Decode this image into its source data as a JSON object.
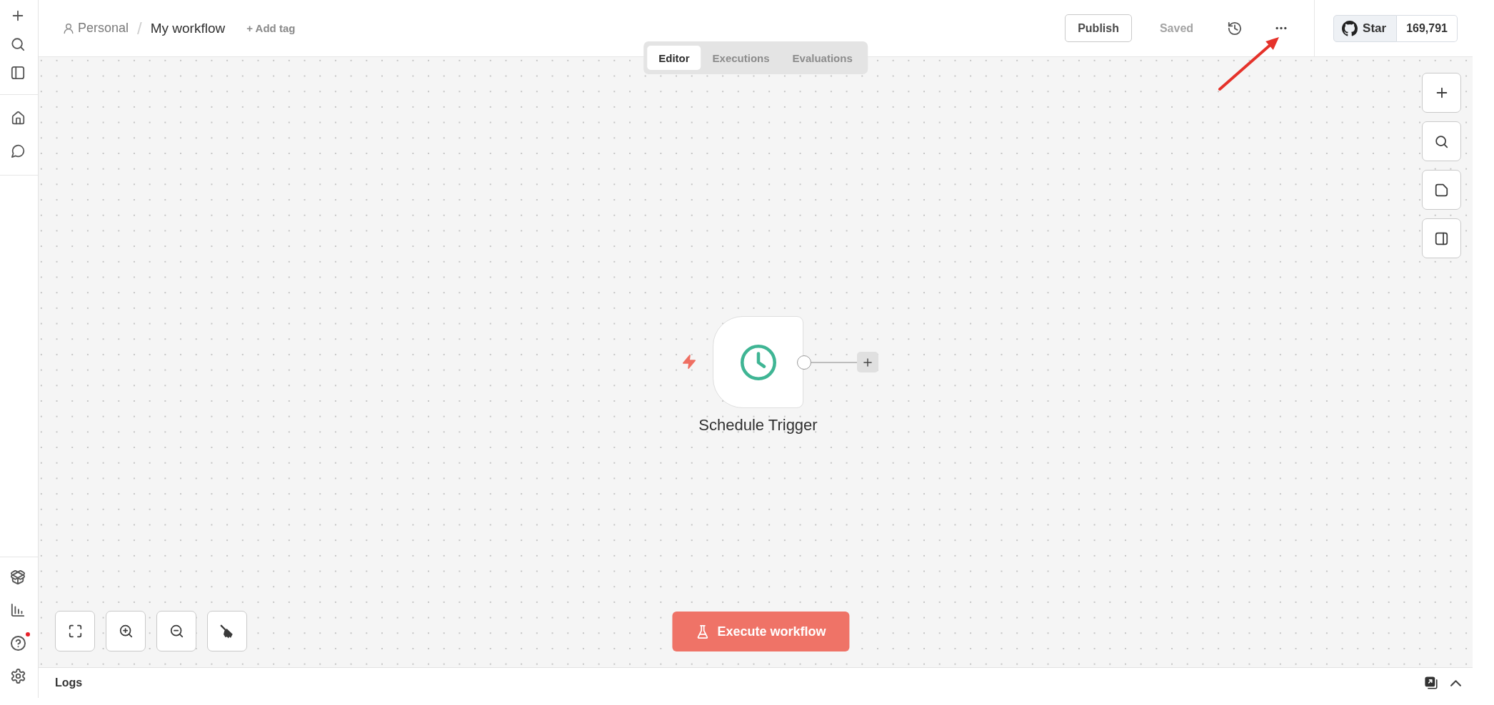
{
  "sidebar": {
    "help_notification": true
  },
  "header": {
    "breadcrumb": {
      "project": "Personal",
      "separator": "/",
      "workflow_name": "My workflow",
      "add_tag": "+ Add tag"
    },
    "publish_button": "Publish",
    "save_status": "Saved",
    "github_star": {
      "label": "Star",
      "count": "169,791"
    }
  },
  "view_tabs": [
    {
      "label": "Editor",
      "selected": true
    },
    {
      "label": "Executions",
      "selected": false
    },
    {
      "label": "Evaluations",
      "selected": false
    }
  ],
  "canvas": {
    "nodes": [
      {
        "kind": "trigger",
        "label": "Schedule Trigger"
      }
    ],
    "execute_button": "Execute workflow"
  },
  "logs_panel": {
    "title": "Logs"
  }
}
